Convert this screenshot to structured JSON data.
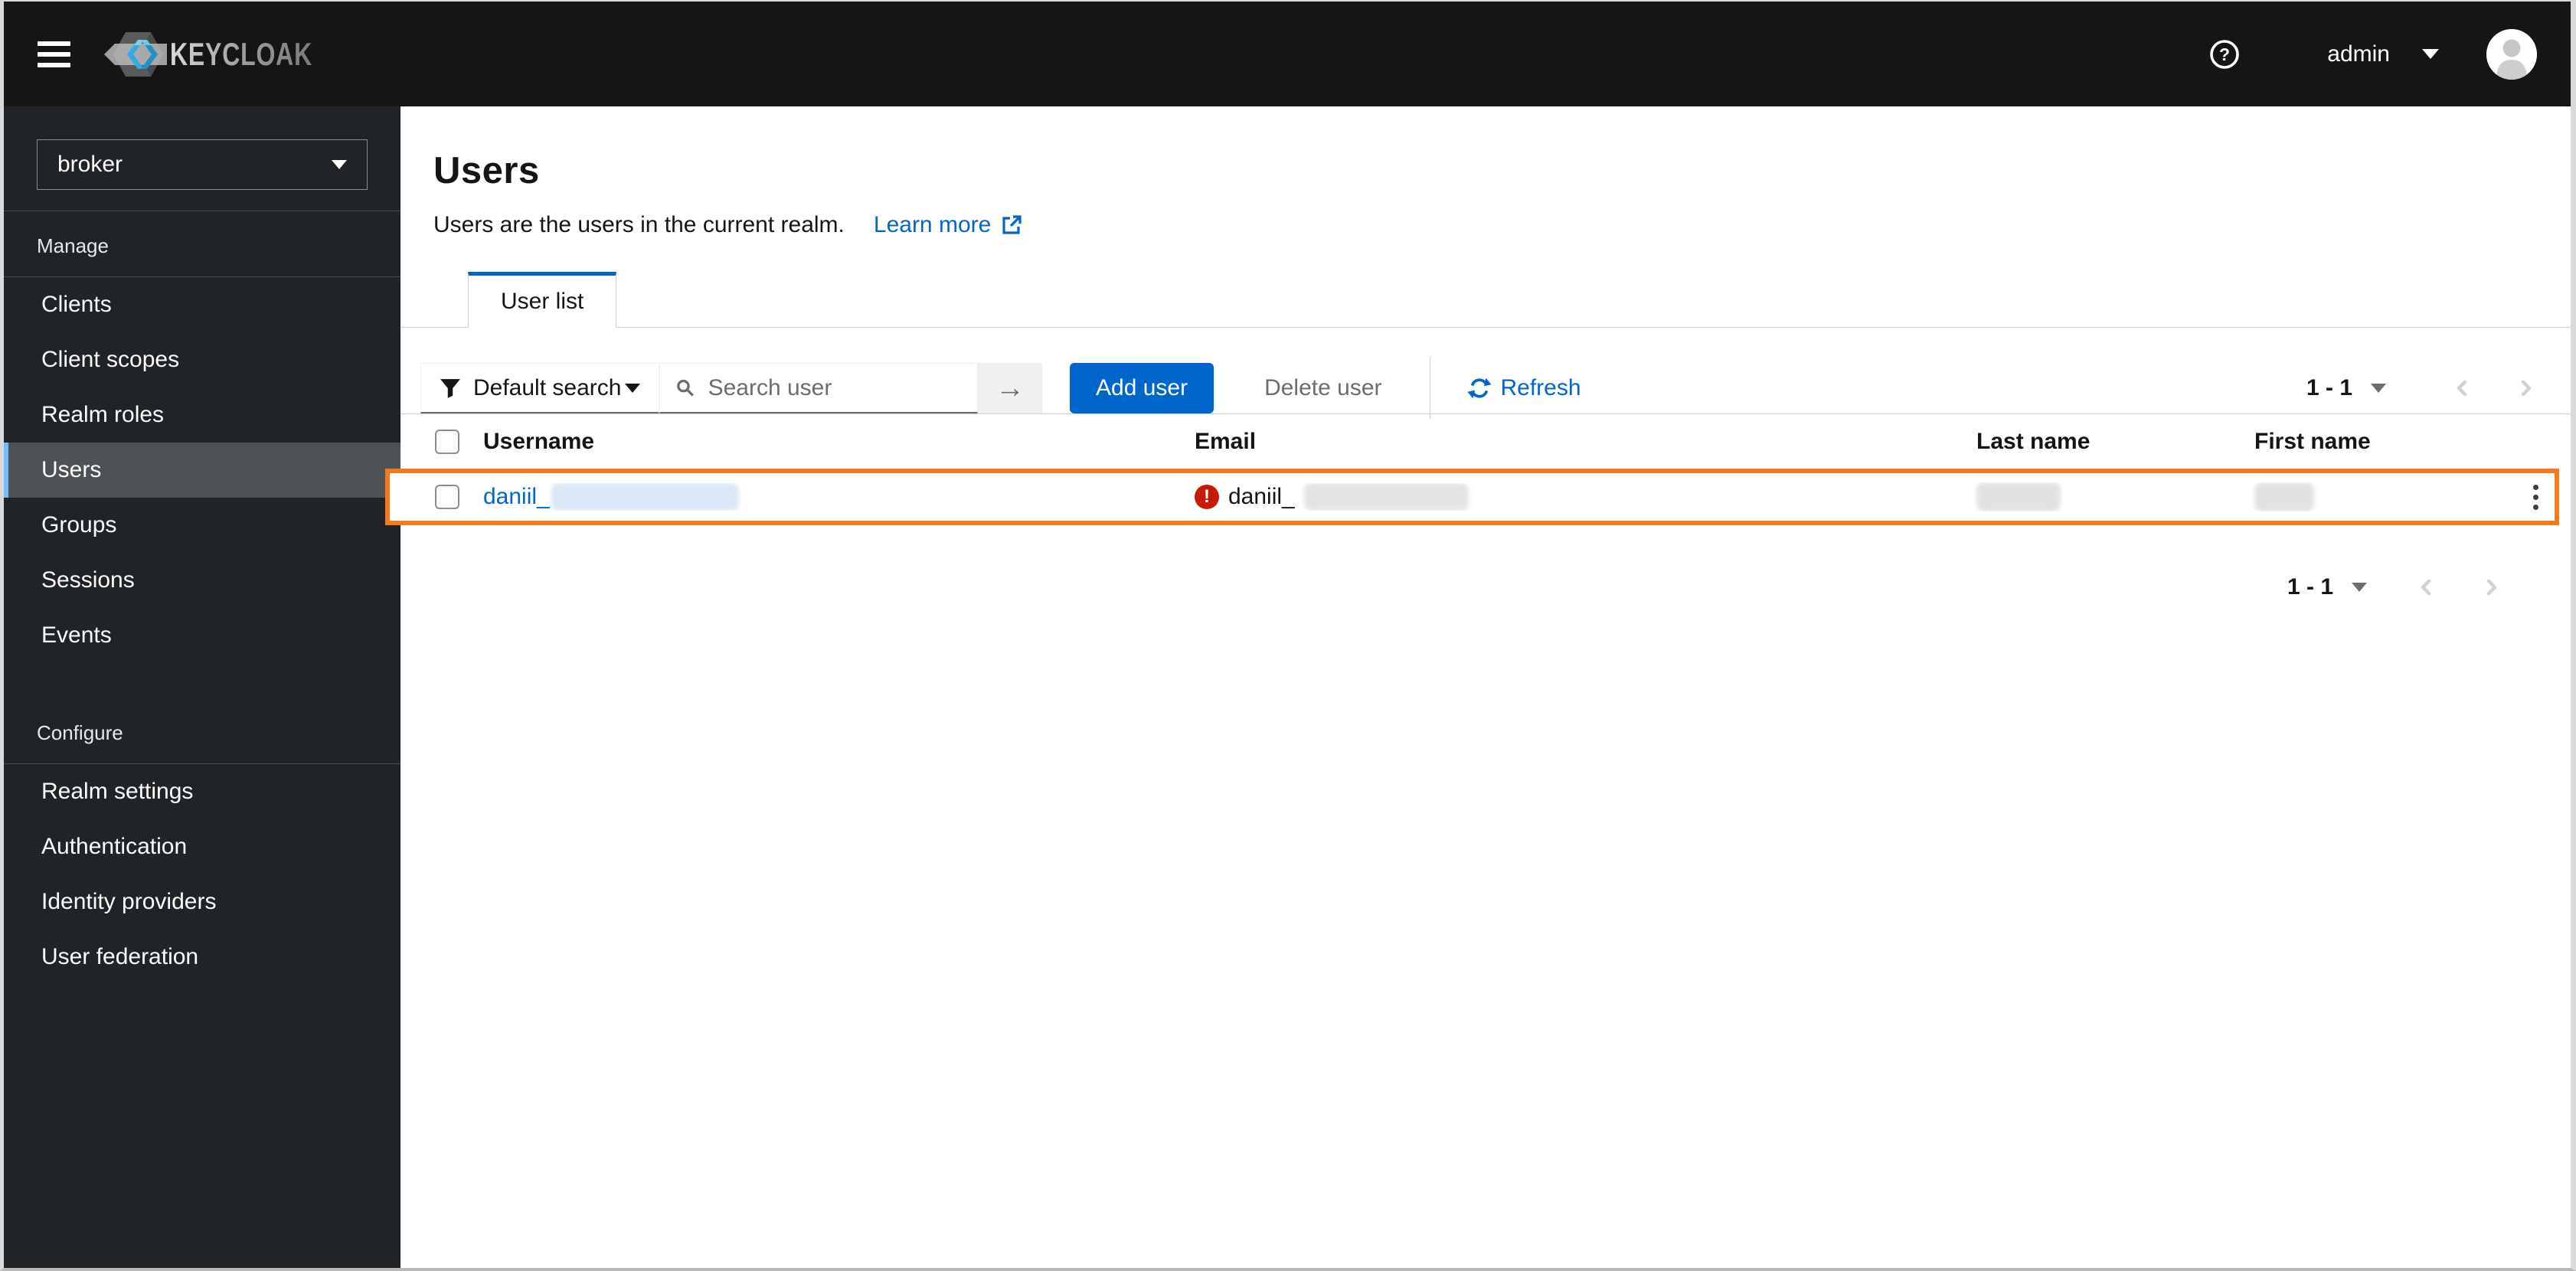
{
  "header": {
    "brand": "KEYCLOAK",
    "username": "admin"
  },
  "sidebar": {
    "realm_selector": {
      "value": "broker"
    },
    "sections": [
      {
        "label": "Manage",
        "items": [
          {
            "label": "Clients",
            "selected": false
          },
          {
            "label": "Client scopes",
            "selected": false
          },
          {
            "label": "Realm roles",
            "selected": false
          },
          {
            "label": "Users",
            "selected": true
          },
          {
            "label": "Groups",
            "selected": false
          },
          {
            "label": "Sessions",
            "selected": false
          },
          {
            "label": "Events",
            "selected": false
          }
        ]
      },
      {
        "label": "Configure",
        "items": [
          {
            "label": "Realm settings",
            "selected": false
          },
          {
            "label": "Authentication",
            "selected": false
          },
          {
            "label": "Identity providers",
            "selected": false
          },
          {
            "label": "User federation",
            "selected": false
          }
        ]
      }
    ]
  },
  "main": {
    "title": "Users",
    "description": "Users are the users in the current realm.",
    "learn_more_label": "Learn more",
    "tabs": [
      {
        "label": "User list",
        "active": true
      }
    ],
    "toolbar": {
      "filter_label": "Default search",
      "search_placeholder": "Search user",
      "arrow_glyph": "→",
      "add_user_label": "Add user",
      "delete_user_label": "Delete user",
      "refresh_label": "Refresh",
      "pagination_range": "1 - 1"
    },
    "table": {
      "columns": [
        "Username",
        "Email",
        "Last name",
        "First name"
      ],
      "rows": [
        {
          "username": "daniil_",
          "username_redacted": true,
          "email": "daniil_",
          "email_error": true,
          "error_glyph": "!",
          "last_name_redacted": true,
          "first_name_redacted": true,
          "highlighted": true
        }
      ]
    },
    "bottom_pagination_range": "1 - 1"
  },
  "icons": {
    "hamburger": "hamburger",
    "help": "question-circle",
    "caret_down": "caret-down",
    "filter": "funnel",
    "search": "magnifier",
    "arrow_right": "arrow-right",
    "refresh": "sync",
    "external_link": "external-link",
    "error": "exclamation-circle",
    "kebab": "kebab-vertical",
    "chevron_left": "angle-left",
    "chevron_right": "angle-right"
  },
  "colors": {
    "accent_blue": "#0066cc",
    "highlight_orange": "#f4791f",
    "danger_red": "#c9190b",
    "nav_selected_indicator": "#73bcf7",
    "masthead_bg": "#151515",
    "sidebar_bg": "#212427"
  }
}
